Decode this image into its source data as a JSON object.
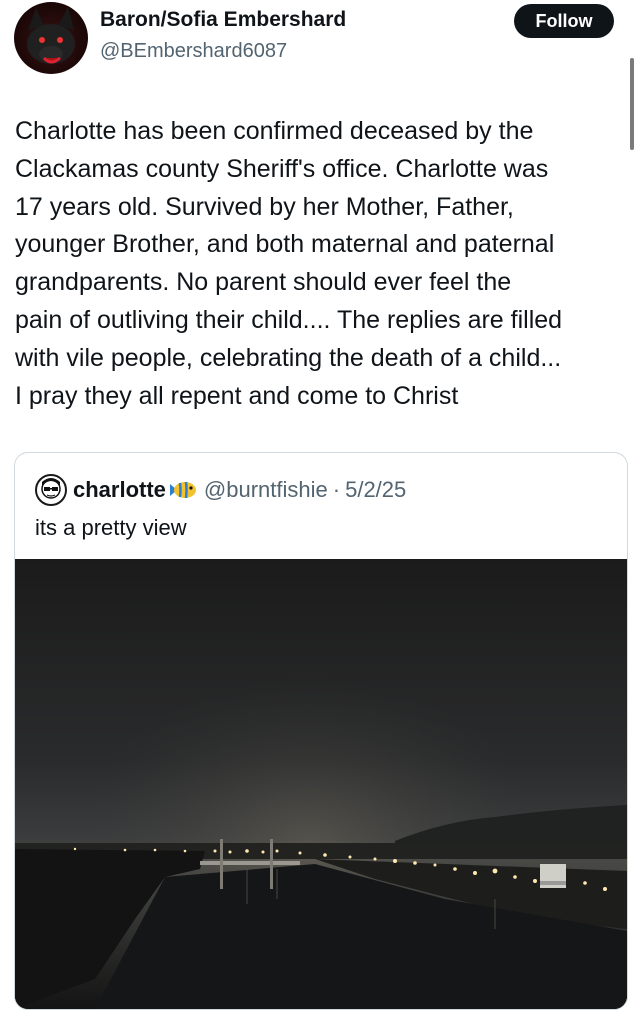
{
  "author": {
    "display_name": "Baron/Sofia Embershard",
    "handle": "@BEmbershard6087",
    "follow_label": "Follow"
  },
  "post": {
    "lines": [
      "Charlotte has been confirmed deceased by the",
      "Clackamas county Sheriff's office. Charlotte was",
      "17 years old. Survived by her Mother, Father,",
      "younger Brother, and both maternal and paternal",
      "grandparents. No parent should ever feel the",
      "pain of outliving their child.... The replies are filled",
      "with vile people, celebrating the death of a child...",
      "I pray they all repent and come to Christ"
    ]
  },
  "quoted": {
    "name": "charlotte",
    "name_emoji_icon": "tropical-fish-icon",
    "handle": "@burntfishie",
    "separator": "·",
    "date": "5/2/25",
    "text": "its a pretty view",
    "media_icon": "night-river-cityscape-photo"
  }
}
